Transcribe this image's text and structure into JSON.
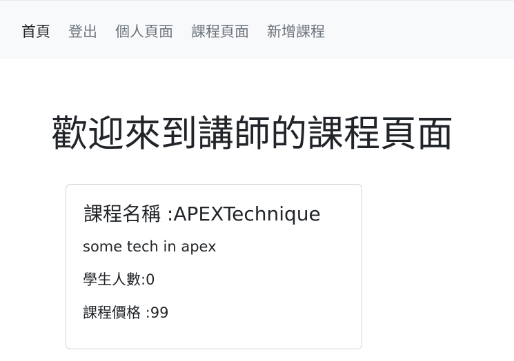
{
  "nav": {
    "items": [
      {
        "label": "首頁",
        "active": true
      },
      {
        "label": "登出",
        "active": false
      },
      {
        "label": "個人頁面",
        "active": false
      },
      {
        "label": "課程頁面",
        "active": false
      },
      {
        "label": "新增課程",
        "active": false
      }
    ]
  },
  "page": {
    "title": "歡迎來到講師的課程頁面"
  },
  "course": {
    "title": "課程名稱 :APEXTechnique",
    "description": "some tech in apex",
    "students": "學生人數:0",
    "price": "課程價格 :99"
  }
}
